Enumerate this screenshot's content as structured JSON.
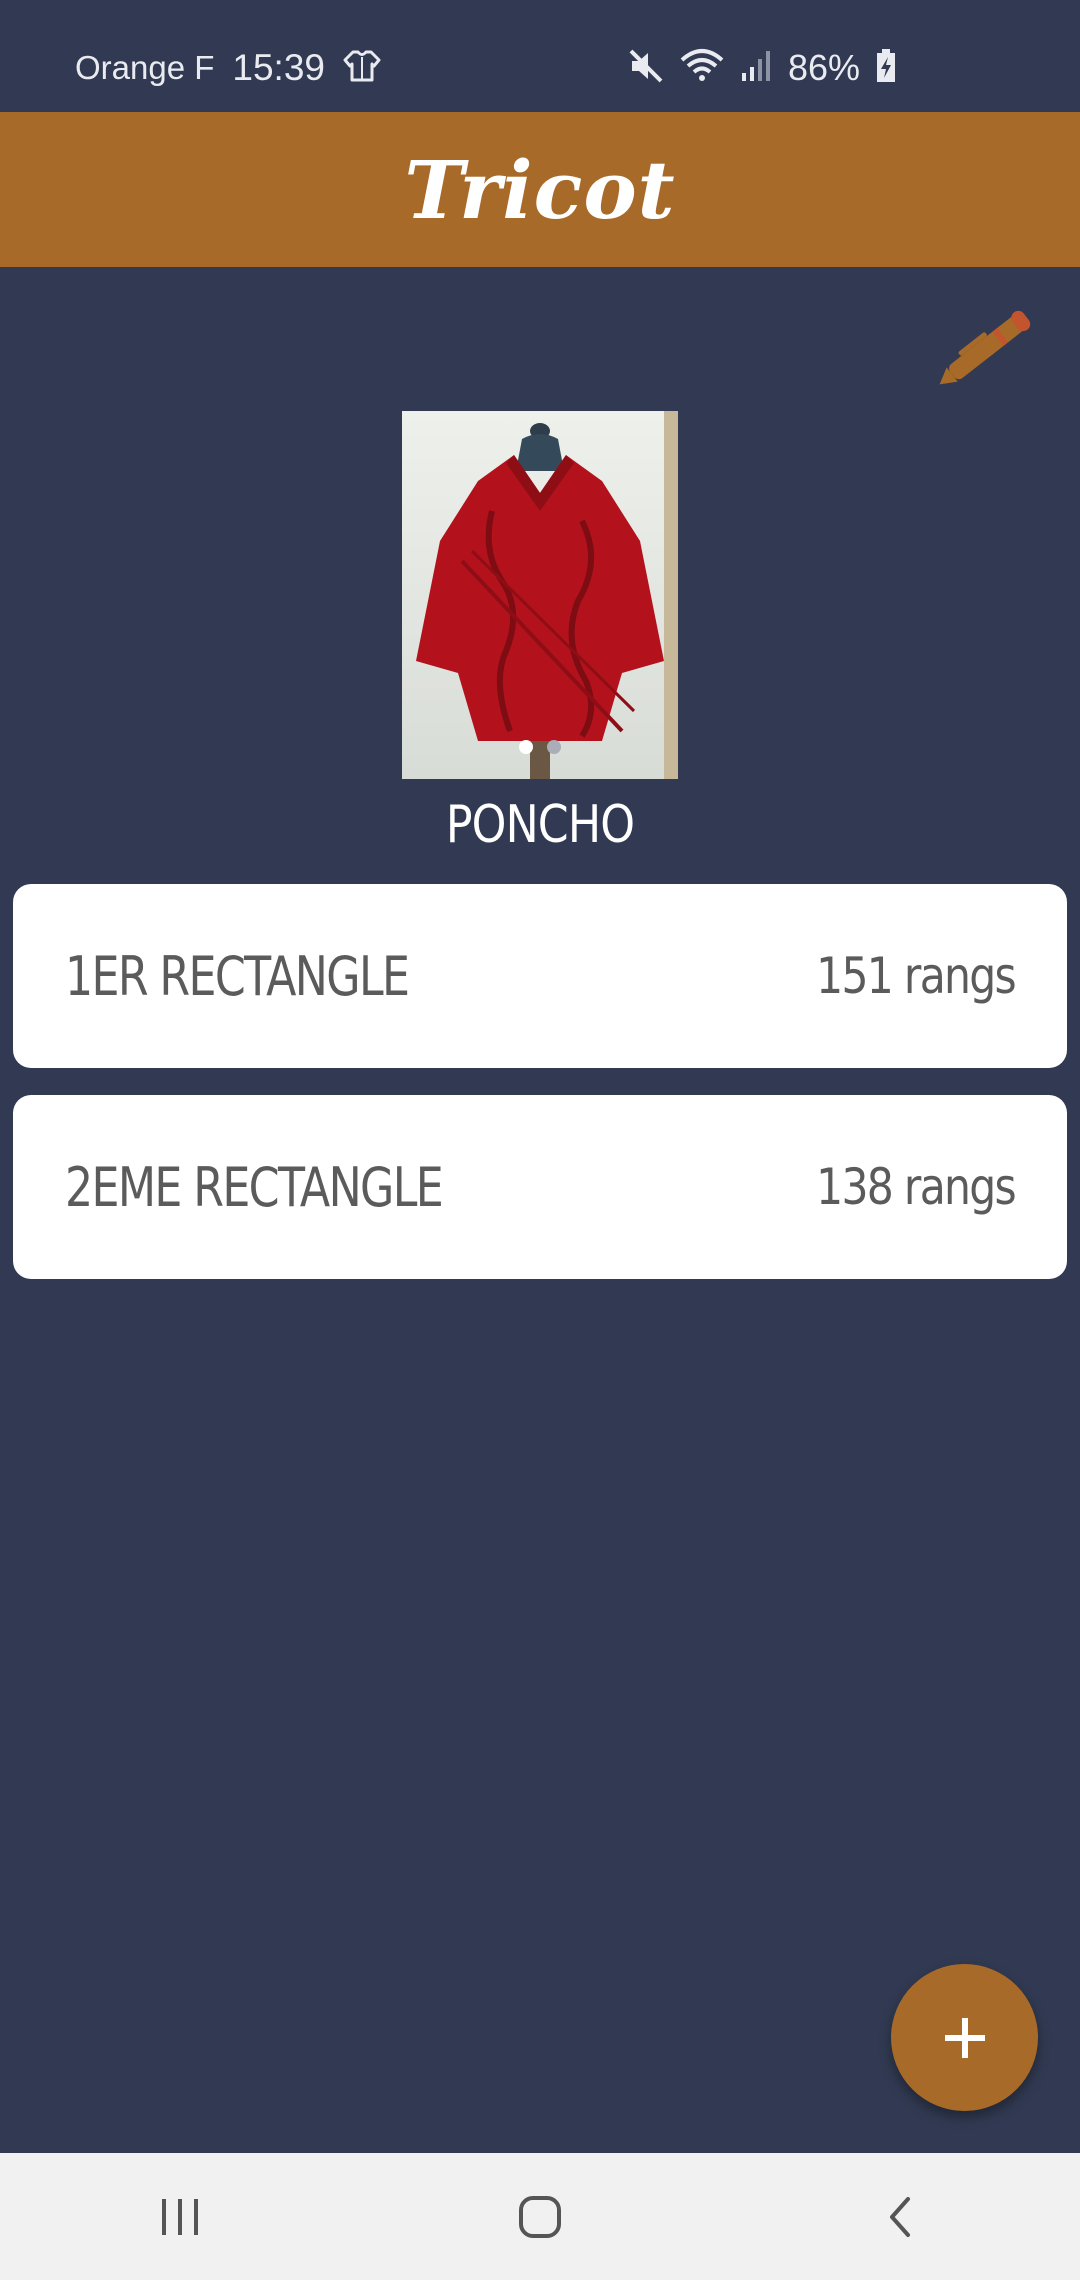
{
  "status_bar": {
    "carrier": "Orange F",
    "time": "15:39",
    "battery": "86%",
    "icons": [
      "sweater-notification-icon",
      "mute-icon",
      "wifi-icon",
      "signal-icon",
      "battery-charging-icon"
    ]
  },
  "app_bar": {
    "title": "Tricot"
  },
  "project": {
    "name": "PONCHO",
    "photo_count": 2,
    "active_photo": 1
  },
  "parts": [
    {
      "name": "1ER RECTANGLE",
      "count": "151 rangs"
    },
    {
      "name": "2EME RECTANGLE",
      "count": "138 rangs"
    }
  ],
  "colors": {
    "background": "#313a52",
    "accent": "#a86a29",
    "card": "#ffffff",
    "card_text": "#5b5b5b",
    "nav_bar": "#f1f1f1"
  },
  "icons": {
    "edit": "pen-icon",
    "fab": "plus-icon",
    "nav": [
      "recent-apps-icon",
      "home-icon",
      "back-icon"
    ]
  }
}
